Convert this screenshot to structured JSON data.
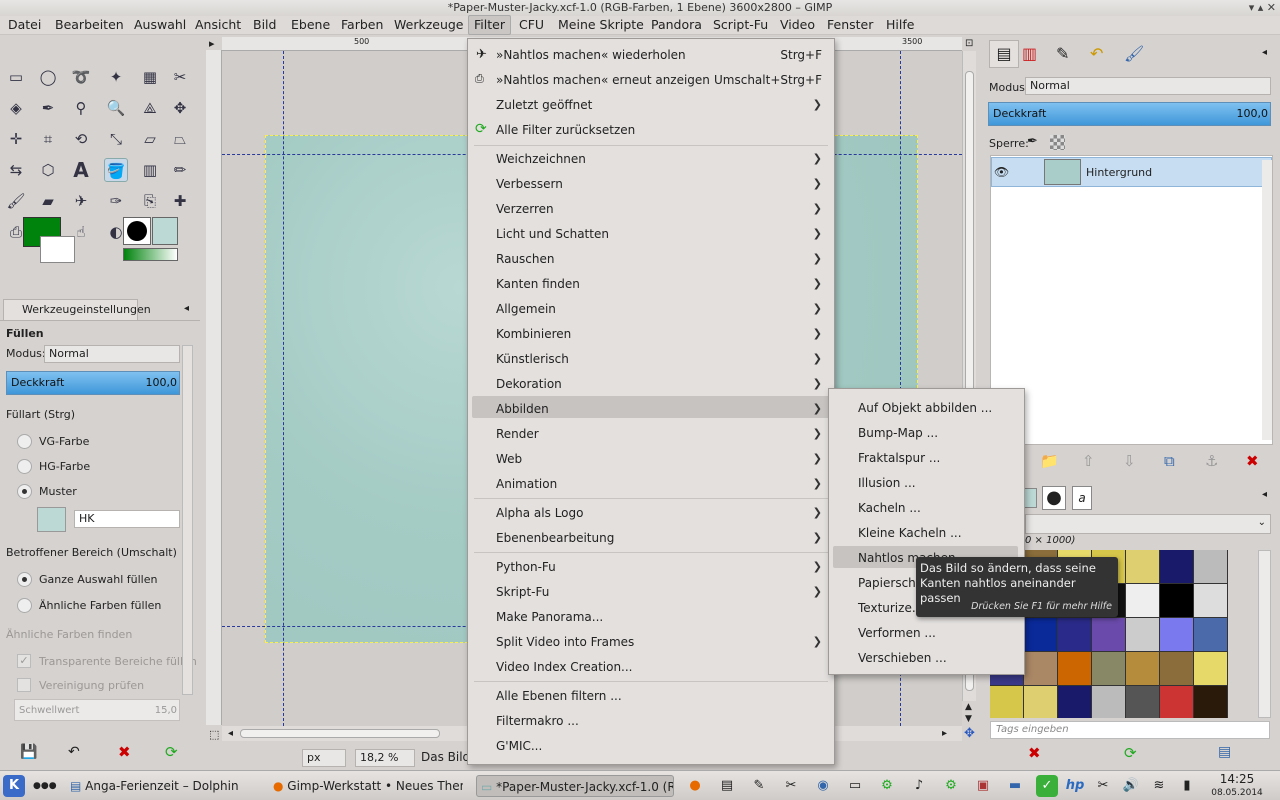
{
  "window": {
    "title": "*Paper-Muster-Jacky.xcf-1.0 (RGB-Farben, 1 Ebene) 3600x2800 – GIMP"
  },
  "menubar": [
    "Datei",
    "Bearbeiten",
    "Auswahl",
    "Ansicht",
    "Bild",
    "Ebene",
    "Farben",
    "Werkzeuge",
    "Filter",
    "CFU",
    "Meine Skripte",
    "Pandora",
    "Script-Fu",
    "Video",
    "Fenster",
    "Hilfe"
  ],
  "tool_options": {
    "tab": "Werkzeugeinstellungen",
    "heading": "Füllen",
    "mode_label": "Modus:",
    "mode_value": "Normal",
    "opacity_label": "Deckkraft",
    "opacity_value": "100,0",
    "fill_type_label": "Füllart (Strg)",
    "fill_fg": "VG-Farbe",
    "fill_bg": "HG-Farbe",
    "fill_pattern": "Muster",
    "pattern_name": "HK",
    "area_label": "Betroffener Bereich (Umschalt)",
    "area_selection": "Ganze Auswahl füllen",
    "area_similar": "Ähnliche Farben füllen",
    "similar_label": "Ähnliche Farben finden",
    "transparent": "Transparente Bereiche füllen",
    "merge": "Vereinigung prüfen",
    "threshold_label": "Schwellwert",
    "threshold_value": "15,0"
  },
  "ruler": {
    "h500": "500",
    "h3500": "3500"
  },
  "status": {
    "unit": "px",
    "zoom": "18,2 %",
    "text": "Das Bild"
  },
  "layers": {
    "mode_label": "Modus:",
    "mode_value": "Normal",
    "opacity_label": "Deckkraft",
    "opacity_value": "100,0",
    "lock_label": "Sperre:",
    "layer_name": "Hintergrund"
  },
  "patterns": {
    "size_label": "0 × 1000)",
    "tags_placeholder": "Tags eingeben"
  },
  "filter_menu": {
    "repeat": "»Nahtlos machen« wiederholen",
    "repeat_sc": "Strg+F",
    "reshow": "»Nahtlos machen« erneut anzeigen",
    "reshow_sc": "Umschalt+Strg+F",
    "recent": "Zuletzt geöffnet",
    "reset": "Alle Filter zurücksetzen",
    "items": [
      "Weichzeichnen",
      "Verbessern",
      "Verzerren",
      "Licht und Schatten",
      "Rauschen",
      "Kanten finden",
      "Allgemein",
      "Kombinieren",
      "Künstlerisch",
      "Dekoration",
      "Abbilden",
      "Render",
      "Web",
      "Animation"
    ],
    "items2": [
      "Alpha als Logo",
      "Ebenenbearbeitung"
    ],
    "items3": [
      "Python-Fu",
      "Skript-Fu",
      "Make Panorama...",
      "Split Video into Frames",
      "Video Index Creation..."
    ],
    "items4": [
      "Alle Ebenen filtern ...",
      "Filtermakro ...",
      "G'MIC..."
    ]
  },
  "submenu": [
    "Auf Objekt abbilden ...",
    "Bump-Map ...",
    "Fraktalspur ...",
    "Illusion ...",
    "Kacheln ...",
    "Kleine Kacheln ...",
    "Nahtlos machen",
    "Papierschn",
    "Texturize...",
    "Verformen ...",
    "Verschieben ..."
  ],
  "tooltip": {
    "text": "Das Bild so ändern, dass seine Kanten nahtlos aneinander passen",
    "help": "Drücken Sie F1 für mehr Hilfe"
  },
  "taskbar": {
    "tasks": [
      "Anga-Ferienzeit – Dolphin",
      "Gimp-Werkstatt • Neues Them",
      "*Paper-Muster-Jacky.xcf-1.0 (R"
    ],
    "time": "14:25",
    "date": "08.05.2014"
  },
  "colors": {
    "fg": "#00830d",
    "accent": "#3f97d9",
    "image": "#a9cdc8"
  }
}
